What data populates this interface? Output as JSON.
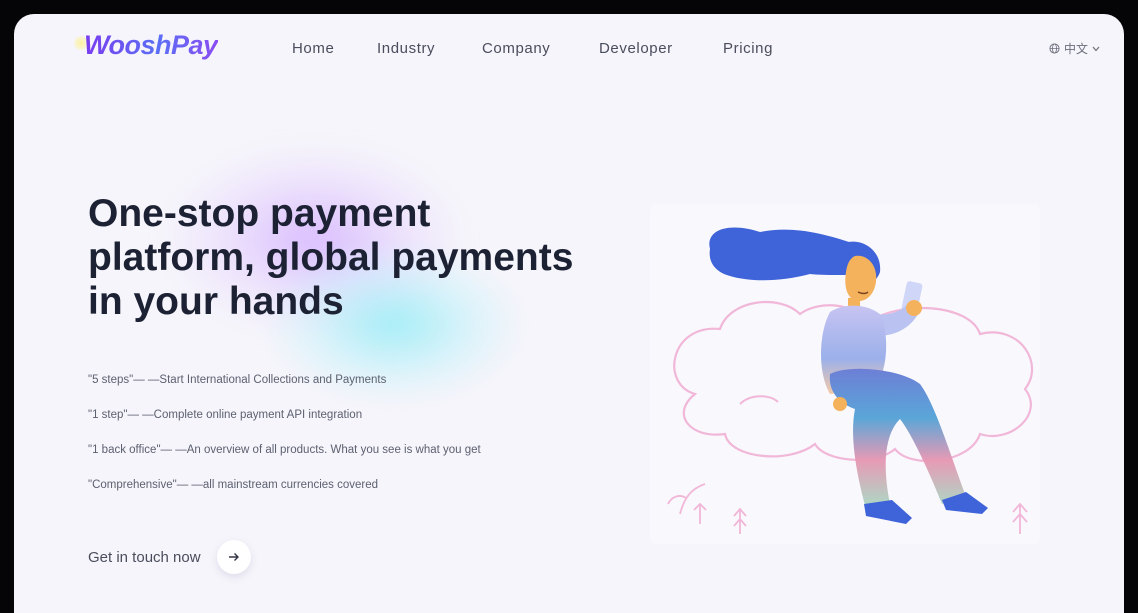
{
  "brand": {
    "logo_text": "WooshPay"
  },
  "nav": {
    "items": [
      "Home",
      "Industry",
      "Company",
      "Developer",
      "Pricing"
    ]
  },
  "language": {
    "label": "中文",
    "icon": "globe-icon"
  },
  "hero": {
    "headline": "One-stop payment platform, global payments in your hands",
    "bullets": [
      "\"5 steps\"— —Start International Collections and Payments",
      "\"1 step\"— —Complete online payment API integration",
      "\"1 back office\"— —An overview of all products. What you see is what you get",
      "\"Comprehensive\"— —all mainstream currencies covered"
    ],
    "cta_label": "Get in touch now",
    "cta_icon": "arrow-right-icon"
  },
  "colors": {
    "brand_purple": "#6a3fe8",
    "headline": "#1c2233",
    "hair": "#3f63d8",
    "background": "#f6f5fb"
  }
}
